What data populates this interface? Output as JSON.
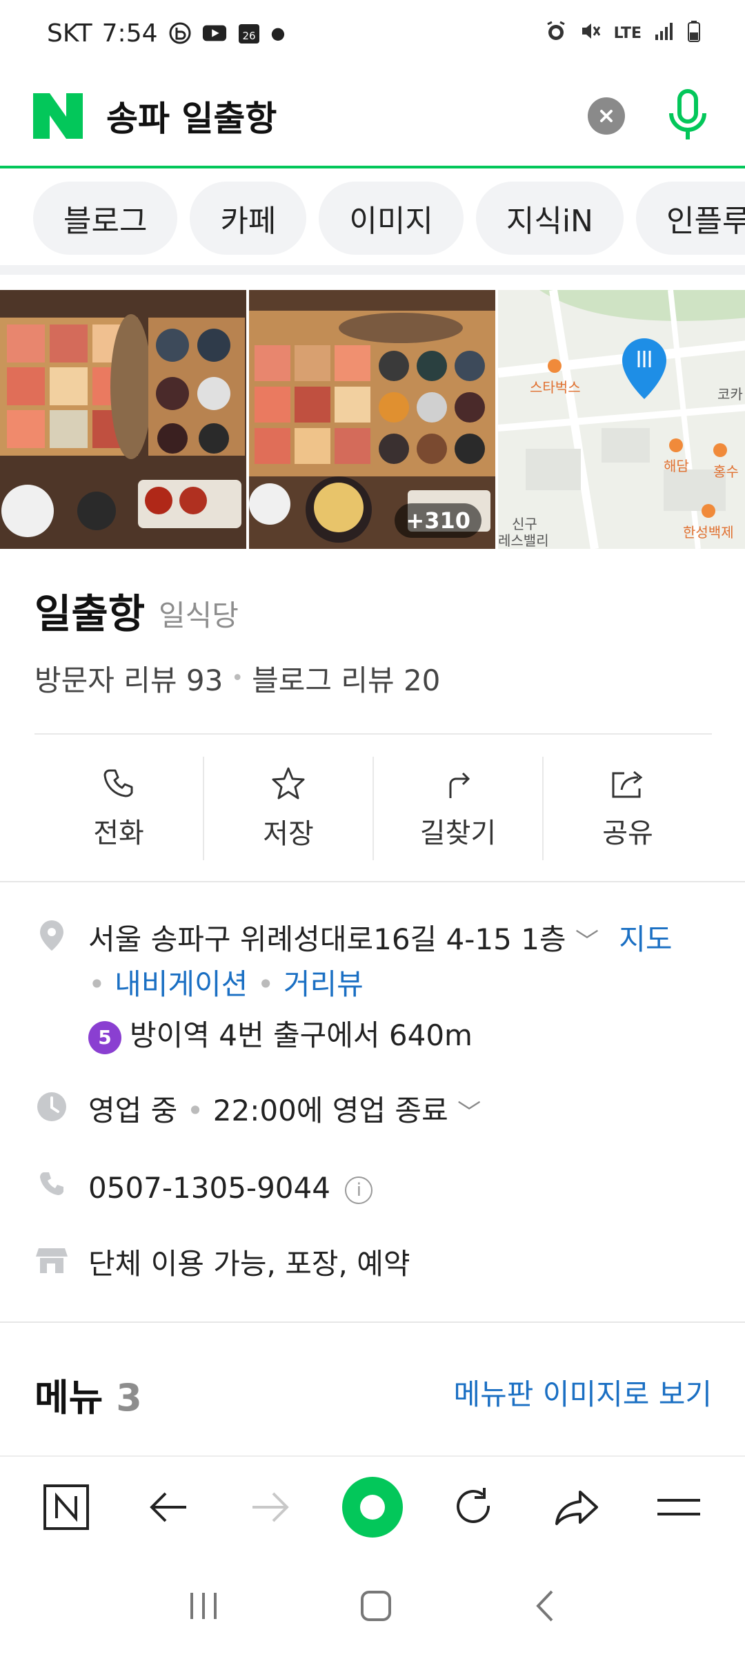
{
  "status_bar": {
    "carrier": "SKT",
    "time": "7:54",
    "calendar_day": "26",
    "network": "LTE"
  },
  "search": {
    "query": "송파 일출항",
    "brand_color": "#03c75a"
  },
  "tabs": [
    "블로그",
    "카페",
    "이미지",
    "지식iN",
    "인플루"
  ],
  "photos": {
    "more_count": "+310",
    "map_labels": [
      "스타벅스",
      "해담",
      "홍수",
      "한성백제",
      "신구",
      "레스밸리",
      "코카"
    ]
  },
  "place": {
    "name": "일출항",
    "category": "일식당",
    "visitor_review": "방문자 리뷰 93",
    "blog_review": "블로그 리뷰 20"
  },
  "actions": [
    {
      "label": "전화",
      "icon": "phone-icon"
    },
    {
      "label": "저장",
      "icon": "star-icon"
    },
    {
      "label": "길찾기",
      "icon": "directions-icon"
    },
    {
      "label": "공유",
      "icon": "share-icon"
    }
  ],
  "info": {
    "address": "서울 송파구 위례성대로16길 4-15 1층",
    "map_link": "지도",
    "navigation_link": "내비게이션",
    "streetview_link": "거리뷰",
    "subway_line": "5",
    "subway_line_color": "#8a3fd1",
    "subway_text": "방이역 4번 출구에서 640m",
    "hours_status": "영업 중",
    "hours_detail": "22:00에 영업 종료",
    "phone": "0507-1305-9044",
    "amenities": "단체 이용 가능, 포장, 예약"
  },
  "menu": {
    "title": "메뉴",
    "count": "3",
    "image_link": "메뉴판 이미지로 보기"
  },
  "colors": {
    "link": "#1a6fc3",
    "accent_green": "#03c75a"
  }
}
